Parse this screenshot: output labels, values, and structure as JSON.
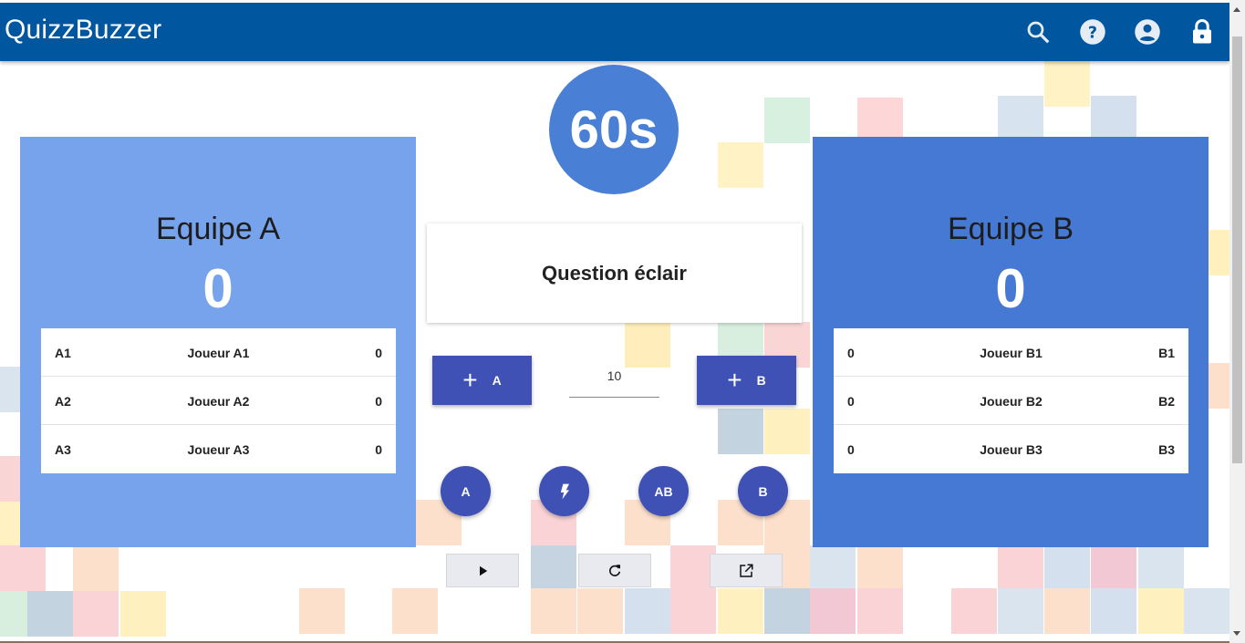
{
  "app": {
    "title": "QuizzBuzzer"
  },
  "header_icons": [
    "search-icon",
    "help-icon",
    "account-icon",
    "lock-icon"
  ],
  "colors": {
    "appbar": "#0057a0",
    "team_a": "#77a2ec",
    "team_b": "#4679d4",
    "timer": "#4a7fd6",
    "primary_button": "#3f51b5"
  },
  "timer": {
    "label": "60s"
  },
  "question": {
    "title": "Question éclair"
  },
  "team_a": {
    "name": "Equipe A",
    "score": "0",
    "players": [
      {
        "code": "A1",
        "name": "Joueur A1",
        "score": "0"
      },
      {
        "code": "A2",
        "name": "Joueur A2",
        "score": "0"
      },
      {
        "code": "A3",
        "name": "Joueur A3",
        "score": "0"
      }
    ]
  },
  "team_b": {
    "name": "Equipe B",
    "score": "0",
    "players": [
      {
        "code": "B1",
        "name": "Joueur B1",
        "score": "0"
      },
      {
        "code": "B2",
        "name": "Joueur B2",
        "score": "0"
      },
      {
        "code": "B3",
        "name": "Joueur B3",
        "score": "0"
      }
    ]
  },
  "controls": {
    "add_a_label": "A",
    "add_b_label": "B",
    "points_value": "10",
    "buzz_buttons": {
      "a": "A",
      "ab": "AB",
      "b": "B"
    }
  }
}
